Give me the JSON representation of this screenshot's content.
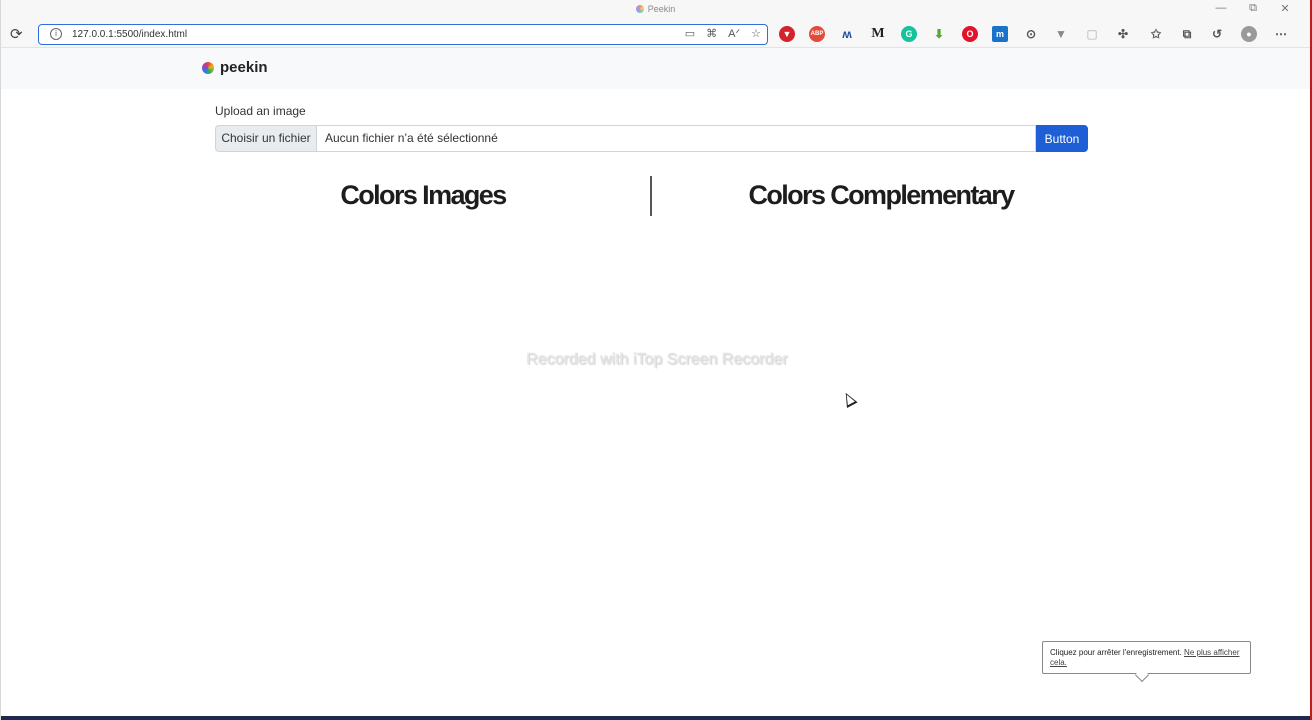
{
  "window": {
    "title": "Peekin",
    "controls": {
      "minimize": "—",
      "restore": "⧉",
      "close": "✕"
    }
  },
  "toolbar": {
    "url": "127.0.0.1:5500/index.html",
    "extensions": [
      "bitwarden-icon",
      "adblock-icon",
      "malwarebytes-icon",
      "medium-icon",
      "grammarly-icon",
      "downloader-icon",
      "opera-icon",
      "mendeley-icon",
      "speed-dial-icon",
      "vuejs-icon",
      "blank-extension-icon",
      "extensions-puzzle-icon",
      "favorites-icon",
      "collections-icon",
      "history-icon",
      "profile-icon",
      "more-menu-icon"
    ],
    "ext_glyphs": {
      "adblock": "ABP",
      "medium": "M",
      "grammarly": "G",
      "opera": "O",
      "mendeley": "m"
    },
    "colors": {
      "url_border": "#2f6fdb"
    }
  },
  "navbar": {
    "brand": "peekin"
  },
  "upload": {
    "label": "Upload an image",
    "file_button": "Choisir un fichier",
    "file_status": "Aucun fichier n’a été sélectionné",
    "submit": "Button"
  },
  "sections": {
    "left_heading": "Colors Images",
    "right_heading": "Colors Complementary"
  },
  "watermark": "Recorded with iTop Screen Recorder",
  "recorder_tooltip": {
    "text": "Cliquez pour arrêter l'enregistrement.",
    "link": "Ne plus afficher cela."
  },
  "colors": {
    "primary_button": "#1e5fd6",
    "navbar_bg": "#f8f9fa",
    "frame_accent": "#c21b1b"
  }
}
